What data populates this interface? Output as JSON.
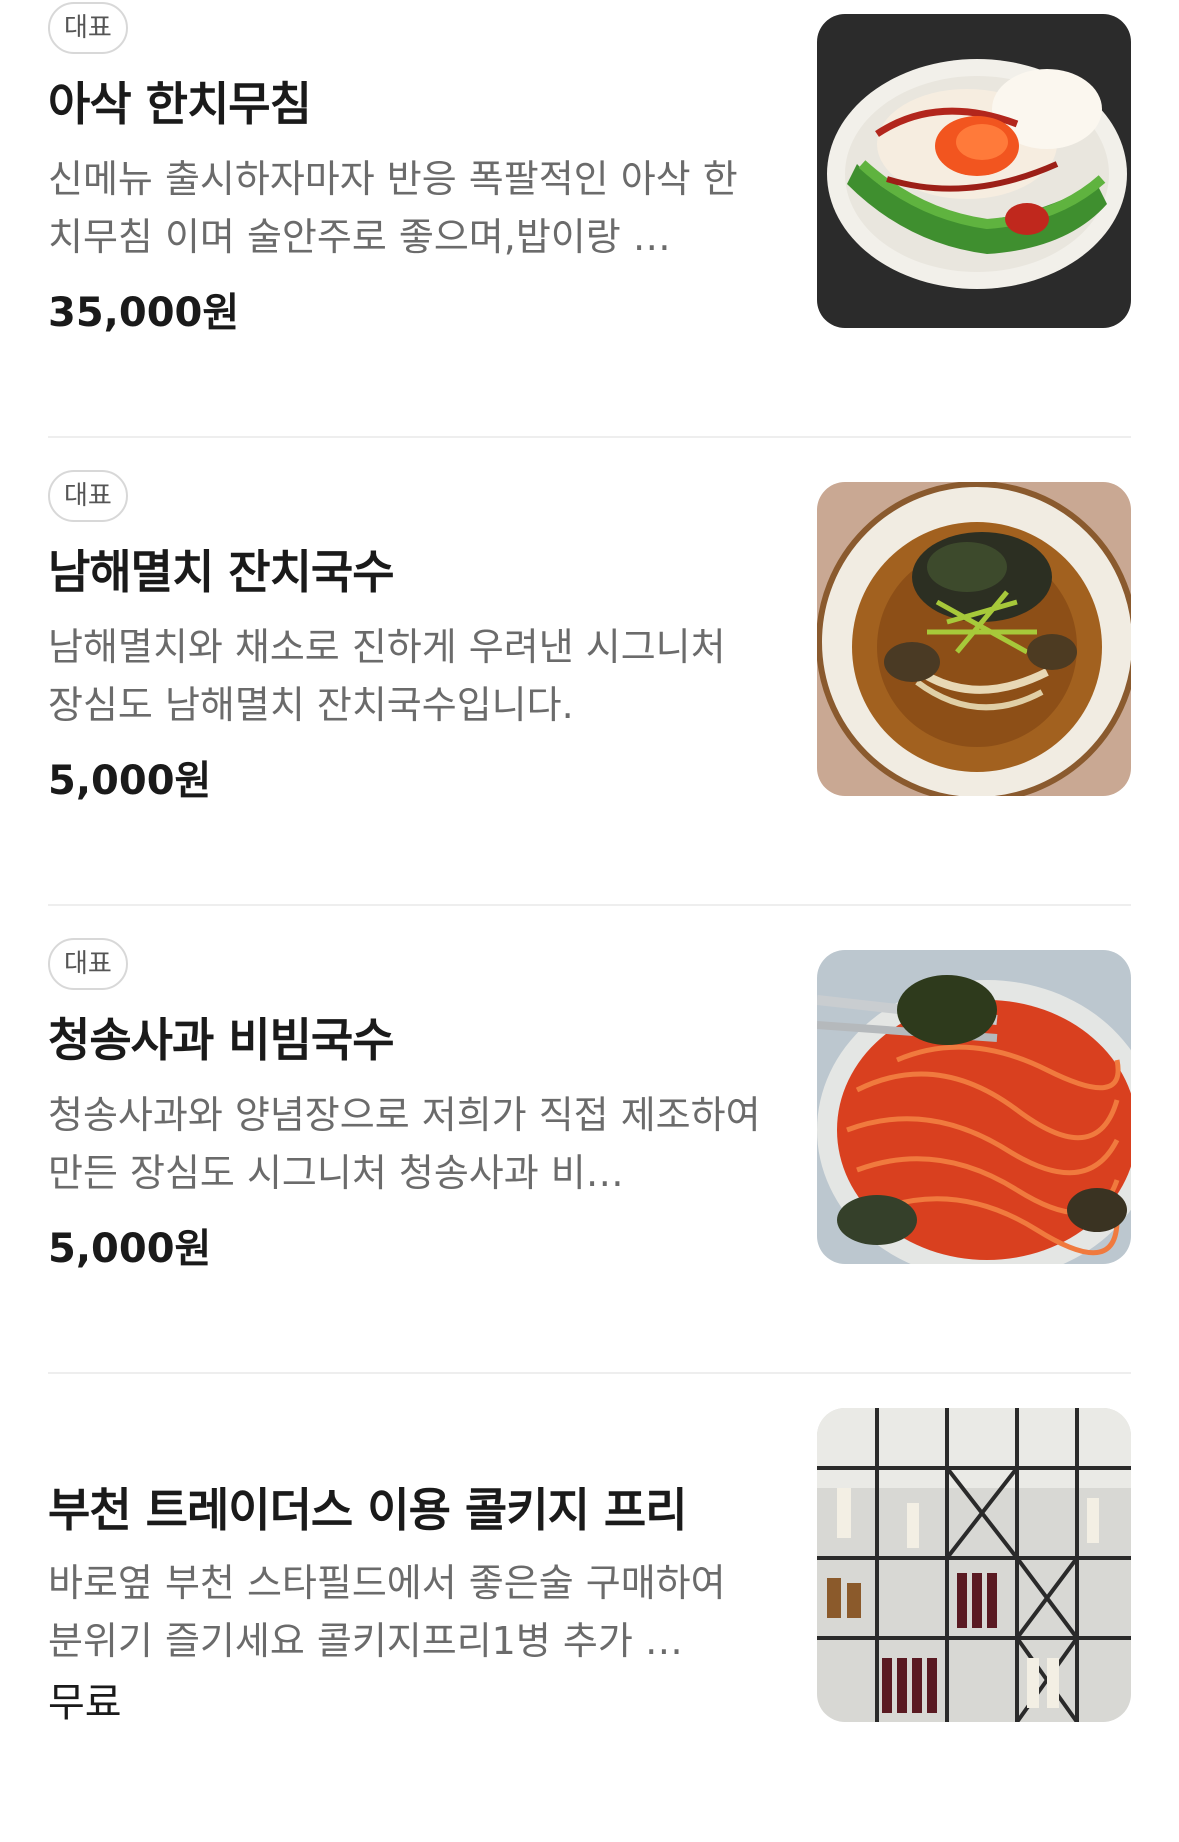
{
  "menu": [
    {
      "badge": "대표",
      "title": "아삭 한치무침",
      "description": "신메뉴 출시하자마자 반응 폭팔적인 아삭 한치무침 이며 술안주로 좋으며,밥이랑 …",
      "price": "35,000원",
      "image_icon": "squid-salad-photo"
    },
    {
      "badge": "대표",
      "title": "남해멸치 잔치국수",
      "description": "남해멸치와 채소로 진하게 우려낸 시그니처 장심도 남해멸치 잔치국수입니다.",
      "price": "5,000원",
      "image_icon": "noodle-soup-photo"
    },
    {
      "badge": "대표",
      "title": "청송사과 비빔국수",
      "description": "청송사과와 양념장으로 저희가 직접 제조하여 만든 장심도 시그니처 청송사과 비…",
      "price": "5,000원",
      "image_icon": "spicy-noodles-photo"
    },
    {
      "badge": "",
      "title": "부천 트레이더스 이용 콜키지 프리",
      "description": "바로옆 부천 스타필드에서 좋은술 구매하여 분위기 즐기세요 콜키지프리1병 추가 …",
      "price": "무료",
      "image_icon": "wine-shelf-photo"
    }
  ]
}
